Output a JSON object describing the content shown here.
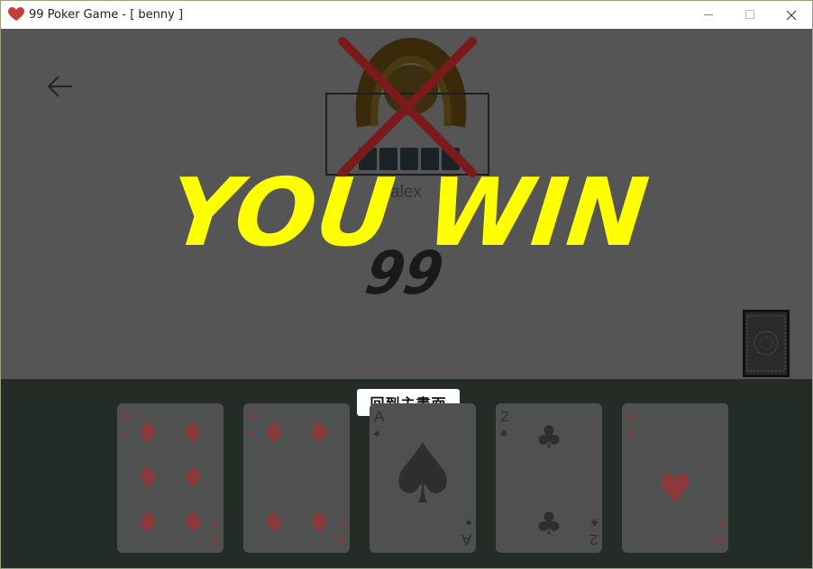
{
  "window": {
    "title": "99 Poker Game - [ benny ]",
    "icon": "heart-icon",
    "controls": [
      "minimize-icon",
      "maximize-icon",
      "close-icon"
    ]
  },
  "game": {
    "opponent": {
      "name": "alex",
      "status": "eliminated",
      "hand_card_count": 5
    },
    "result_text": "YOU WIN",
    "score": "99",
    "home_button_label": "回到主畫面",
    "deck_icon": "card-back-icon",
    "back_icon": "back-arrow-icon",
    "player_hand": [
      {
        "rank": "6",
        "suit": "diamonds",
        "color": "red"
      },
      {
        "rank": "4",
        "suit": "diamonds",
        "color": "red"
      },
      {
        "rank": "A",
        "suit": "spades",
        "color": "black"
      },
      {
        "rank": "2",
        "suit": "clubs",
        "color": "black"
      },
      {
        "rank": "A",
        "suit": "hearts",
        "color": "red"
      }
    ]
  },
  "colors": {
    "table_top": "#555555",
    "table_bottom": "#242c28",
    "win_text": "#ffff00",
    "elimination_cross": "#7a1a1a",
    "button_bg": "#ffffff"
  }
}
